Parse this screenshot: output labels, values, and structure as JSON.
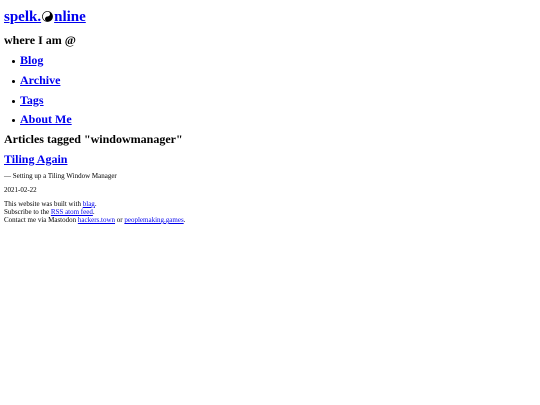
{
  "site": {
    "title_start": "spelk.",
    "title_end": "nline",
    "tagline": "where I am @"
  },
  "nav": {
    "items": [
      {
        "label": "Blog"
      },
      {
        "label": "Archive"
      },
      {
        "label": "Tags"
      },
      {
        "label": "About Me"
      }
    ]
  },
  "main": {
    "heading": "Articles tagged \"windowmanager\"",
    "articles": [
      {
        "title": "Tiling Again",
        "summary": "— Setting up a Tiling Window Manager",
        "date": "2021-02-22"
      }
    ]
  },
  "footer": {
    "built_with_prefix": "This website was built with",
    "built_with_link": "blag",
    "built_with_suffix": ".",
    "subscribe_prefix": "Subscribe to the",
    "subscribe_link": "RSS atom feed",
    "subscribe_suffix": ".",
    "contact_prefix": "Contact me via Mastodon",
    "contact_link_1": "hackers.town",
    "contact_or": "or",
    "contact_link_2": "peoplemaking.games",
    "contact_suffix": "."
  },
  "colors": {
    "link": "#0000ee",
    "text": "#000000",
    "background": "#ffffff"
  },
  "icons": {
    "logo": "yin-yang-icon"
  }
}
